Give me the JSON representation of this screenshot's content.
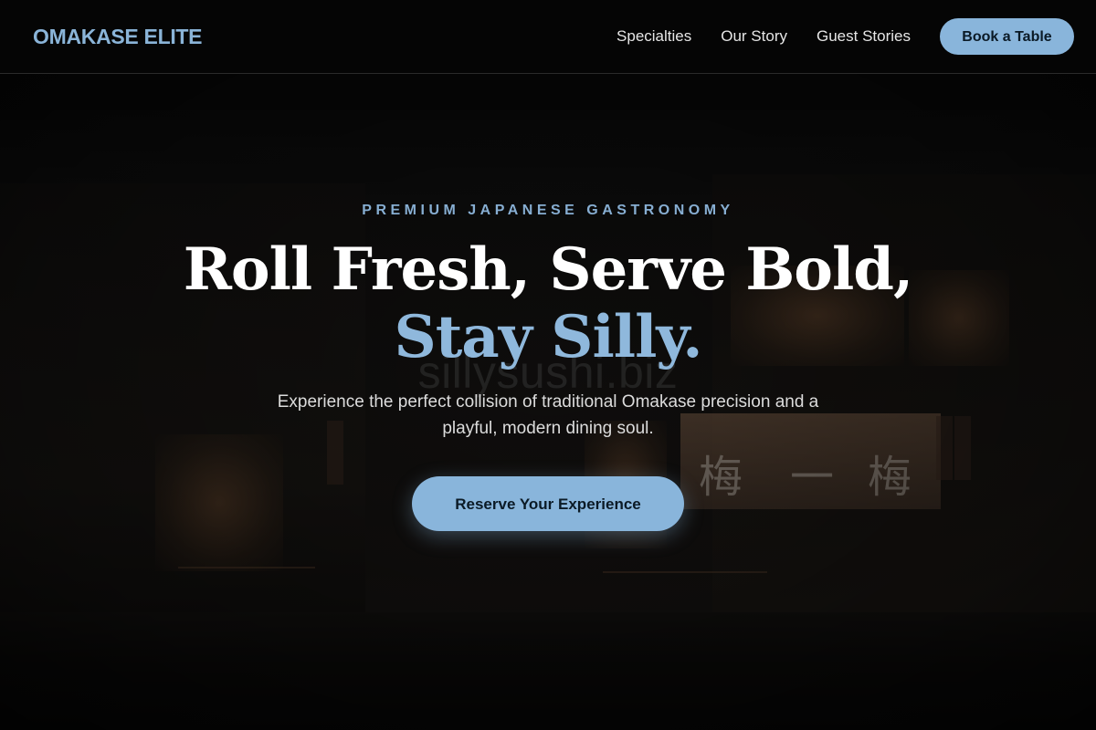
{
  "header": {
    "logo": "OMAKASE ELITE",
    "nav": [
      {
        "label": "Specialties"
      },
      {
        "label": "Our Story"
      },
      {
        "label": "Guest Stories"
      }
    ],
    "cta_label": "Book a Table"
  },
  "hero": {
    "eyebrow": "PREMIUM JAPANESE GASTRONOMY",
    "headline_line1": "Roll Fresh, Serve Bold,",
    "headline_line2": "Stay Silly.",
    "subtext_line1": "Experience the perfect collision of traditional Omakase precision and a",
    "subtext_line2": "playful, modern dining soul.",
    "cta_label": "Reserve Your Experience",
    "watermark": "sillysushi.biz"
  },
  "colors": {
    "accent": "#89b5db",
    "background": "#070707",
    "text": "#ffffff"
  }
}
